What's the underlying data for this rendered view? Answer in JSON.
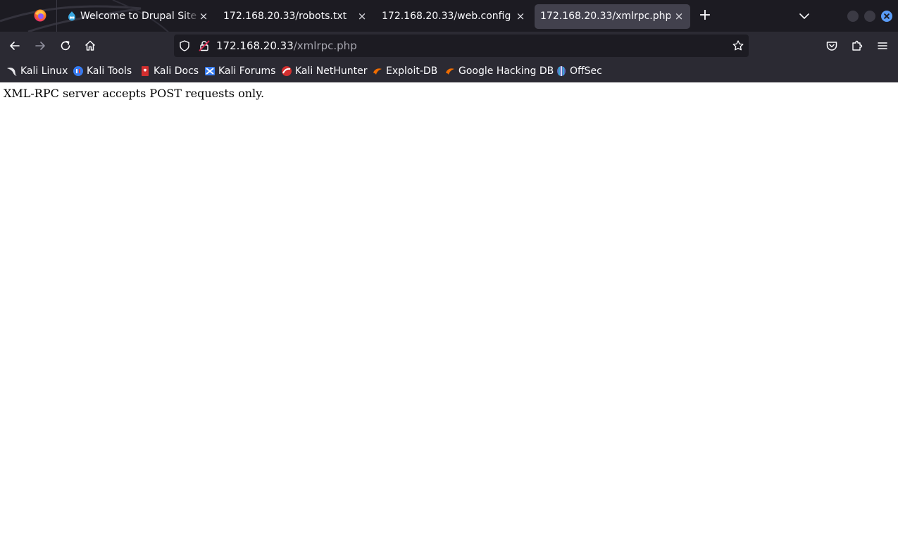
{
  "browser": {
    "tabs": [
      {
        "title": "Welcome to Drupal Site | D",
        "favicon": "drupal-icon",
        "active": false
      },
      {
        "title": "172.168.20.33/robots.txt",
        "favicon": "",
        "active": false
      },
      {
        "title": "172.168.20.33/web.config",
        "favicon": "",
        "active": false
      },
      {
        "title": "172.168.20.33/xmlrpc.php",
        "favicon": "",
        "active": true
      }
    ],
    "close_glyph": "×",
    "new_tab_glyph": "+",
    "url": {
      "host": "172.168.20.33",
      "path": "/xmlrpc.php"
    },
    "bookmarks": [
      {
        "label": "Kali Linux",
        "icon": "kali-dragon-icon"
      },
      {
        "label": "Kali Tools",
        "icon": "kali-tools-icon"
      },
      {
        "label": "Kali Docs",
        "icon": "kali-docs-icon"
      },
      {
        "label": "Kali Forums",
        "icon": "kali-forums-icon"
      },
      {
        "label": "Kali NetHunter",
        "icon": "kali-nethunter-icon"
      },
      {
        "label": "Exploit-DB",
        "icon": "exploit-db-icon"
      },
      {
        "label": "Google Hacking DB",
        "icon": "ghdb-icon"
      },
      {
        "label": "OffSec",
        "icon": "offsec-icon"
      }
    ],
    "colors": {
      "tabstrip": "#1c1b22",
      "toolbar": "#2b2a33",
      "urlbar": "#1c1b22",
      "active_tab": "#42414d",
      "text": "#fbfbfe",
      "url_path": "#a8a7b0",
      "accent": "#5a9cf7"
    }
  },
  "page": {
    "body_text": "XML-RPC server accepts POST requests only."
  }
}
